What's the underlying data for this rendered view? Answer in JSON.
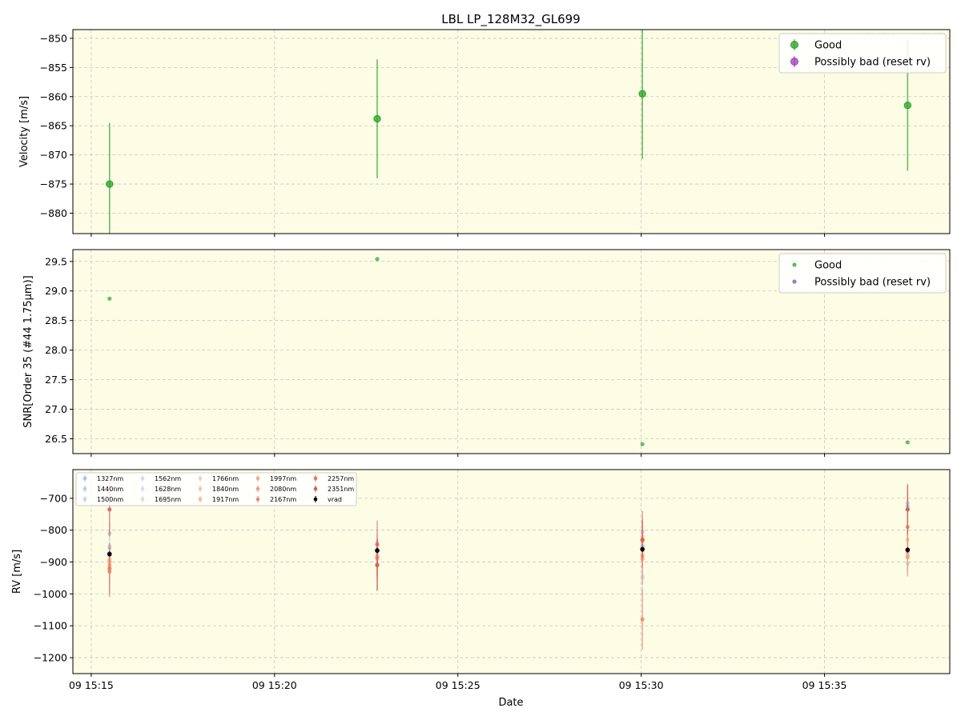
{
  "chart_data": [
    {
      "type": "scatter",
      "title": "LBL LP_128M32_GL699",
      "ylabel": "Velocity [m/s]",
      "ylim": [
        -883.5,
        -848.5
      ],
      "yticks": [
        -880,
        -875,
        -870,
        -865,
        -860,
        -855,
        -850
      ],
      "ytick_labels": [
        "−880",
        "−875",
        "−870",
        "−865",
        "−860",
        "−855",
        "−850"
      ],
      "x": [
        "15:15:30",
        "15:22:48",
        "15:30:02",
        "15:37:16"
      ],
      "series": [
        {
          "name": "Good",
          "color": "#2ca02c",
          "values": [
            -875.0,
            -863.8,
            -859.5,
            -861.5
          ],
          "errors": [
            10.5,
            10.2,
            11.2,
            11.2
          ]
        },
        {
          "name": "Possibly bad (reset rv)",
          "color": "#9b3fb5",
          "values": [],
          "errors": []
        }
      ],
      "legend": "top-right",
      "grid": true
    },
    {
      "type": "scatter",
      "ylabel": "SNR[Order 35 (#44 1.75μm)]",
      "ylim": [
        26.25,
        29.7
      ],
      "yticks": [
        26.5,
        27.0,
        27.5,
        28.0,
        28.5,
        29.0,
        29.5
      ],
      "ytick_labels": [
        "26.5",
        "27.0",
        "27.5",
        "28.0",
        "28.5",
        "29.0",
        "29.5"
      ],
      "x": [
        "15:15:30",
        "15:22:48",
        "15:30:02",
        "15:37:16"
      ],
      "series": [
        {
          "name": "Good",
          "color": "#2ca02c",
          "values": [
            28.87,
            29.54,
            26.41,
            26.44
          ]
        },
        {
          "name": "Possibly bad (reset rv)",
          "color": "#9b3fb5",
          "values": []
        }
      ],
      "legend": "top-right",
      "grid": true
    },
    {
      "type": "scatter",
      "ylabel": "RV [m/s]",
      "xlabel": "Date",
      "ylim": [
        -1250,
        -610
      ],
      "yticks": [
        -1200,
        -1100,
        -1000,
        -900,
        -800,
        -700
      ],
      "ytick_labels": [
        "−1200",
        "−1100",
        "−1000",
        "−900",
        "−800",
        "−700"
      ],
      "xlim": [
        "15:14:30",
        "15:38:25"
      ],
      "xticks": [
        "15:15:00",
        "15:20:00",
        "15:25:00",
        "15:30:00",
        "15:35:00"
      ],
      "xtick_labels": [
        "09 15:15",
        "09 15:20",
        "09 15:25",
        "09 15:30",
        "09 15:35"
      ],
      "x": [
        "15:15:30",
        "15:22:48",
        "15:30:02",
        "15:37:16"
      ],
      "series": [
        {
          "name": "1327nm",
          "color": "#a3c2f0",
          "values": [
            -855,
            -845,
            -850,
            -725
          ],
          "errors": [
            30,
            30,
            40,
            30
          ]
        },
        {
          "name": "1440nm",
          "color": "#b4cdef",
          "values": [
            -810,
            -905,
            -805,
            -715
          ],
          "errors": [
            35,
            35,
            40,
            35
          ]
        },
        {
          "name": "1500nm",
          "color": "#c3d5ee",
          "values": [
            -850,
            -840,
            -945,
            -905
          ],
          "errors": [
            40,
            40,
            50,
            40
          ]
        },
        {
          "name": "1562nm",
          "color": "#cfdaeb",
          "values": [
            -880,
            -880,
            -950,
            -860
          ],
          "errors": [
            40,
            40,
            50,
            40
          ]
        },
        {
          "name": "1628nm",
          "color": "#d9dde6",
          "values": [
            -870,
            -870,
            -860,
            -870
          ],
          "errors": [
            40,
            40,
            50,
            40
          ]
        },
        {
          "name": "1695nm",
          "color": "#e2ddd0",
          "values": [
            -875,
            -865,
            -870,
            -880
          ],
          "errors": [
            40,
            40,
            50,
            40
          ]
        },
        {
          "name": "1766nm",
          "color": "#ebd3c0",
          "values": [
            -890,
            -860,
            -860,
            -860
          ],
          "errors": [
            45,
            45,
            55,
            45
          ]
        },
        {
          "name": "1840nm",
          "color": "#f1c6ad",
          "values": [
            -900,
            -880,
            -820,
            -830
          ],
          "errors": [
            45,
            70,
            60,
            45
          ]
        },
        {
          "name": "1917nm",
          "color": "#f5b99b",
          "values": [
            -900,
            -885,
            -835,
            -880
          ],
          "errors": [
            50,
            55,
            70,
            50
          ]
        },
        {
          "name": "1997nm",
          "color": "#f4a98b",
          "values": [
            -895,
            -890,
            -890,
            -870
          ],
          "errors": [
            55,
            55,
            80,
            55
          ]
        },
        {
          "name": "2080nm",
          "color": "#f19b7c",
          "values": [
            -910,
            -885,
            -880,
            -885
          ],
          "errors": [
            60,
            60,
            90,
            60
          ]
        },
        {
          "name": "2167nm",
          "color": "#ec8a6d",
          "values": [
            -930,
            -910,
            -1080,
            -790
          ],
          "errors": [
            80,
            80,
            95,
            70
          ]
        },
        {
          "name": "2257nm",
          "color": "#e27764",
          "values": [
            -920,
            -845,
            -830,
            -735
          ],
          "errors": [
            80,
            75,
            90,
            75
          ]
        },
        {
          "name": "2351nm",
          "color": "#d6604d",
          "values": [
            -735,
            -910,
            -830,
            -735
          ],
          "errors": [
            85,
            80,
            60,
            80
          ]
        },
        {
          "name": "vrad",
          "color": "#000000",
          "values": [
            -875,
            -864,
            -860,
            -862
          ],
          "errors": [
            8,
            8,
            8,
            8
          ]
        }
      ],
      "legend": "top-left",
      "grid": true
    }
  ]
}
